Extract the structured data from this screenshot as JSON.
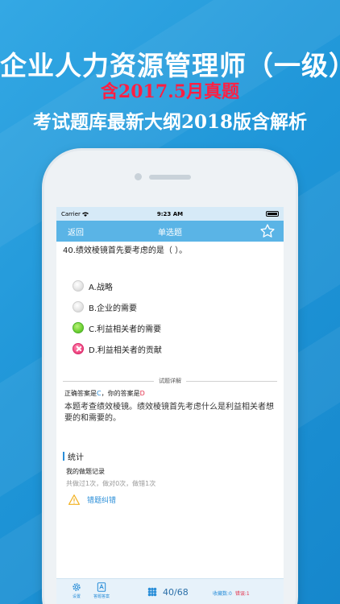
{
  "headline": {
    "title": "企业人力资源管理师（一级）",
    "subtitle_red": "含2017.5月真题",
    "subtitle": "考试题库最新大纲2018版含解析"
  },
  "status_bar": {
    "carrier": "Carrier",
    "time": "9:23 AM"
  },
  "nav": {
    "back_label": "返回",
    "title": "单选题",
    "favorite_icon": "star-outline-icon"
  },
  "question": {
    "text": "40.绩效棱镜首先要考虑的是（ ）。",
    "options": [
      {
        "label": "A.战略",
        "state": "unselected"
      },
      {
        "label": "B.企业的需要",
        "state": "unselected"
      },
      {
        "label": "C.利益相关者的需要",
        "state": "correct"
      },
      {
        "label": "D.利益相关者的贡献",
        "state": "wrong"
      }
    ]
  },
  "detail": {
    "section_title": "试题详解",
    "correct_prefix": "正确答案是",
    "correct_answer": "C",
    "your_prefix": "，你的答案是",
    "your_answer": "D",
    "explanation": "本题考查绩效棱镜。绩效棱镜首先考虑什么是利益相关者想要的和需要的。"
  },
  "stats": {
    "title": "统计",
    "record_label": "我的做题记录",
    "record_text": "共做过1次，做对0次，做错1次",
    "report_label": "错题纠错"
  },
  "tab_bar": {
    "settings_label": "设置",
    "answer_sheet_label": "答题答案",
    "progress": "40/68",
    "favorites_text": "收藏数:0",
    "errors_text": "错误:1"
  },
  "colors": {
    "background": "#1f96d8",
    "nav_bar": "#5ab4e6",
    "accent": "#2a8ed8",
    "correct": "#6fd033",
    "wrong": "#f24c85",
    "headline_red": "#ff1f43"
  }
}
